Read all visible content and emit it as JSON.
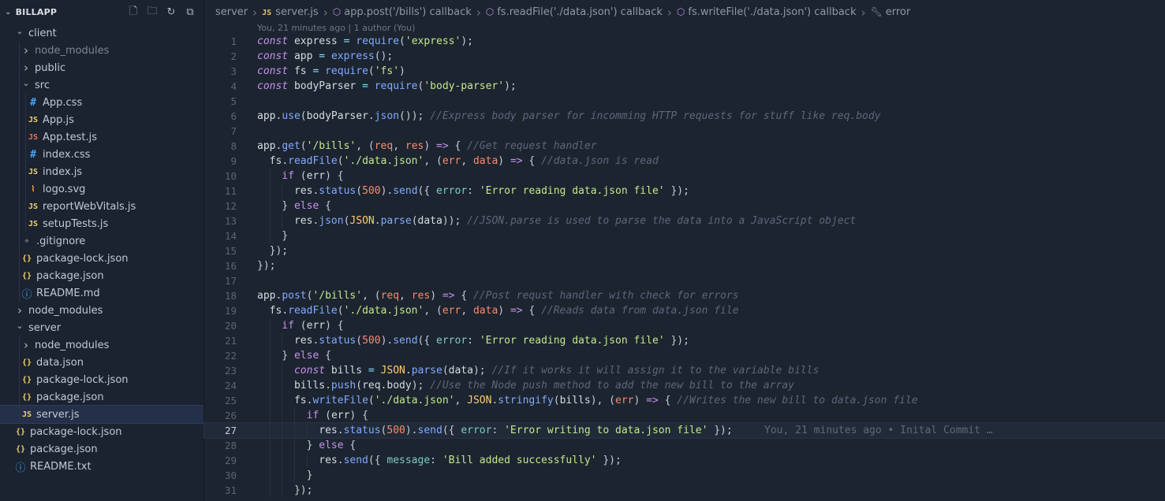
{
  "explorer": {
    "title": "BILLAPP",
    "actions": [
      {
        "name": "new-file-icon",
        "glyph": "🗋"
      },
      {
        "name": "new-folder-icon",
        "glyph": "🗀"
      },
      {
        "name": "refresh-icon",
        "glyph": "↻"
      },
      {
        "name": "collapse-all-icon",
        "glyph": "⧉"
      }
    ],
    "tree": [
      {
        "label": "client",
        "type": "folder",
        "open": true,
        "depth": 0
      },
      {
        "label": "node_modules",
        "type": "folder",
        "open": false,
        "depth": 1,
        "dim": true
      },
      {
        "label": "public",
        "type": "folder",
        "open": false,
        "depth": 1
      },
      {
        "label": "src",
        "type": "folder",
        "open": true,
        "depth": 1
      },
      {
        "label": "App.css",
        "type": "css",
        "depth": 2
      },
      {
        "label": "App.js",
        "type": "js",
        "depth": 2
      },
      {
        "label": "App.test.js",
        "type": "test",
        "depth": 2
      },
      {
        "label": "index.css",
        "type": "css",
        "depth": 2
      },
      {
        "label": "index.js",
        "type": "js",
        "depth": 2
      },
      {
        "label": "logo.svg",
        "type": "svg",
        "depth": 2
      },
      {
        "label": "reportWebVitals.js",
        "type": "js",
        "depth": 2
      },
      {
        "label": "setupTests.js",
        "type": "js",
        "depth": 2
      },
      {
        "label": ".gitignore",
        "type": "git",
        "depth": 1
      },
      {
        "label": "package-lock.json",
        "type": "json",
        "depth": 1
      },
      {
        "label": "package.json",
        "type": "json",
        "depth": 1
      },
      {
        "label": "README.md",
        "type": "info",
        "depth": 1
      },
      {
        "label": "node_modules",
        "type": "folder",
        "open": false,
        "depth": 0
      },
      {
        "label": "server",
        "type": "folder",
        "open": true,
        "depth": 0
      },
      {
        "label": "node_modules",
        "type": "folder",
        "open": false,
        "depth": 1
      },
      {
        "label": "data.json",
        "type": "json",
        "depth": 1
      },
      {
        "label": "package-lock.json",
        "type": "json",
        "depth": 1
      },
      {
        "label": "package.json",
        "type": "json",
        "depth": 1
      },
      {
        "label": "server.js",
        "type": "js",
        "depth": 1,
        "selected": true
      },
      {
        "label": "package-lock.json",
        "type": "json",
        "depth": 0,
        "nochev": true
      },
      {
        "label": "package.json",
        "type": "json",
        "depth": 0,
        "nochev": true
      },
      {
        "label": "README.txt",
        "type": "info",
        "depth": 0,
        "nochev": true
      }
    ],
    "icons": {
      "css": {
        "glyph": "#",
        "color": "#42a5f5",
        "name": "css-file-icon"
      },
      "js": {
        "glyph": "JS",
        "color": "#f0d267",
        "name": "js-file-icon"
      },
      "test": {
        "glyph": "JS",
        "color": "#f0704f",
        "name": "test-file-icon"
      },
      "svg": {
        "glyph": "⌇",
        "color": "#ffb13b",
        "name": "svg-file-icon"
      },
      "git": {
        "glyph": "◆",
        "color": "#58606c",
        "name": "git-file-icon"
      },
      "json": {
        "glyph": "{}",
        "color": "#f0d267",
        "name": "json-file-icon"
      },
      "info": {
        "glyph": "ⓘ",
        "color": "#42a5f5",
        "name": "info-file-icon"
      }
    }
  },
  "breadcrumb": {
    "items": [
      {
        "label": "server",
        "icon": ""
      },
      {
        "label": "server.js",
        "icon": "js"
      },
      {
        "label": "app.post('/bills') callback",
        "icon": "cube"
      },
      {
        "label": "fs.readFile('./data.json') callback",
        "icon": "cube"
      },
      {
        "label": "fs.writeFile('./data.json') callback",
        "icon": "cube"
      },
      {
        "label": "error",
        "icon": "wrench"
      }
    ]
  },
  "blame": {
    "top": "You, 21 minutes ago | 1 author (You)",
    "inline": "You, 21 minutes ago • Inital Commit …",
    "current_line": 27
  },
  "code": [
    [
      [
        "kw",
        "const"
      ],
      [
        "id",
        " express "
      ],
      [
        "pu",
        "="
      ],
      [
        "id",
        " "
      ],
      [
        "fn",
        "require"
      ],
      [
        "pl",
        "("
      ],
      [
        "str",
        "'express'"
      ],
      [
        "pl",
        ");"
      ]
    ],
    [
      [
        "kw",
        "const"
      ],
      [
        "id",
        " app "
      ],
      [
        "pu",
        "="
      ],
      [
        "id",
        " "
      ],
      [
        "fn",
        "express"
      ],
      [
        "pl",
        "();"
      ]
    ],
    [
      [
        "kw",
        "const"
      ],
      [
        "id",
        " fs "
      ],
      [
        "pu",
        "="
      ],
      [
        "id",
        " "
      ],
      [
        "fn",
        "require"
      ],
      [
        "pl",
        "("
      ],
      [
        "str",
        "'fs'"
      ],
      [
        "pl",
        ")"
      ]
    ],
    [
      [
        "kw",
        "const"
      ],
      [
        "id",
        " bodyParser "
      ],
      [
        "pu",
        "="
      ],
      [
        "id",
        " "
      ],
      [
        "fn",
        "require"
      ],
      [
        "pl",
        "("
      ],
      [
        "str",
        "'body-parser'"
      ],
      [
        "pl",
        ");"
      ]
    ],
    [],
    [
      [
        "id",
        "app"
      ],
      [
        "pl",
        "."
      ],
      [
        "fn",
        "use"
      ],
      [
        "pl",
        "("
      ],
      [
        "id",
        "bodyParser"
      ],
      [
        "pl",
        "."
      ],
      [
        "fn",
        "json"
      ],
      [
        "pl",
        "()); "
      ],
      [
        "cm",
        "//Express body parser for incomming HTTP requests for stuff like req.body"
      ]
    ],
    [],
    [
      [
        "id",
        "app"
      ],
      [
        "pl",
        "."
      ],
      [
        "fn",
        "get"
      ],
      [
        "pl",
        "("
      ],
      [
        "str",
        "'/bills'"
      ],
      [
        "pl",
        ", ("
      ],
      [
        "pm",
        "req"
      ],
      [
        "pl",
        ", "
      ],
      [
        "pm",
        "res"
      ],
      [
        "pl",
        ") "
      ],
      [
        "kw2",
        "=>"
      ],
      [
        "pl",
        " { "
      ],
      [
        "cm",
        "//Get request handler"
      ]
    ],
    [
      [
        "id",
        "  fs"
      ],
      [
        "pl",
        "."
      ],
      [
        "fn",
        "readFile"
      ],
      [
        "pl",
        "("
      ],
      [
        "str",
        "'./data.json'"
      ],
      [
        "pl",
        ", ("
      ],
      [
        "pm",
        "err"
      ],
      [
        "pl",
        ", "
      ],
      [
        "pm",
        "data"
      ],
      [
        "pl",
        ") "
      ],
      [
        "kw2",
        "=>"
      ],
      [
        "pl",
        " { "
      ],
      [
        "cm",
        "//data.json is read"
      ]
    ],
    [
      [
        "kw2",
        "    if"
      ],
      [
        "pl",
        " ("
      ],
      [
        "id",
        "err"
      ],
      [
        "pl",
        ") {"
      ]
    ],
    [
      [
        "id",
        "      res"
      ],
      [
        "pl",
        "."
      ],
      [
        "fn",
        "status"
      ],
      [
        "pl",
        "("
      ],
      [
        "num",
        "500"
      ],
      [
        "pl",
        ")."
      ],
      [
        "fn",
        "send"
      ],
      [
        "pl",
        "({ "
      ],
      [
        "prop",
        "error"
      ],
      [
        "pl",
        ": "
      ],
      [
        "str",
        "'Error reading data.json file'"
      ],
      [
        "pl",
        " });"
      ]
    ],
    [
      [
        "pl",
        "    } "
      ],
      [
        "kw2",
        "else"
      ],
      [
        "pl",
        " {"
      ]
    ],
    [
      [
        "id",
        "      res"
      ],
      [
        "pl",
        "."
      ],
      [
        "fn",
        "json"
      ],
      [
        "pl",
        "("
      ],
      [
        "cls",
        "JSON"
      ],
      [
        "pl",
        "."
      ],
      [
        "fn",
        "parse"
      ],
      [
        "pl",
        "("
      ],
      [
        "id",
        "data"
      ],
      [
        "pl",
        "));"
      ],
      [
        "cm",
        " //JSON.parse is used to parse the data into a JavaScript object"
      ]
    ],
    [
      [
        "pl",
        "    }"
      ]
    ],
    [
      [
        "pl",
        "  });"
      ]
    ],
    [
      [
        "pl",
        "});"
      ]
    ],
    [],
    [
      [
        "id",
        "app"
      ],
      [
        "pl",
        "."
      ],
      [
        "fn",
        "post"
      ],
      [
        "pl",
        "("
      ],
      [
        "str",
        "'/bills'"
      ],
      [
        "pl",
        ", ("
      ],
      [
        "pm",
        "req"
      ],
      [
        "pl",
        ", "
      ],
      [
        "pm",
        "res"
      ],
      [
        "pl",
        ") "
      ],
      [
        "kw2",
        "=>"
      ],
      [
        "pl",
        " { "
      ],
      [
        "cm",
        "//Post requst handler with check for errors"
      ]
    ],
    [
      [
        "id",
        "  fs"
      ],
      [
        "pl",
        "."
      ],
      [
        "fn",
        "readFile"
      ],
      [
        "pl",
        "("
      ],
      [
        "str",
        "'./data.json'"
      ],
      [
        "pl",
        ", ("
      ],
      [
        "pm",
        "err"
      ],
      [
        "pl",
        ", "
      ],
      [
        "pm",
        "data"
      ],
      [
        "pl",
        ") "
      ],
      [
        "kw2",
        "=>"
      ],
      [
        "pl",
        " { "
      ],
      [
        "cm",
        "//Reads data from data.json file"
      ]
    ],
    [
      [
        "kw2",
        "    if"
      ],
      [
        "pl",
        " ("
      ],
      [
        "id",
        "err"
      ],
      [
        "pl",
        ") {"
      ]
    ],
    [
      [
        "id",
        "      res"
      ],
      [
        "pl",
        "."
      ],
      [
        "fn",
        "status"
      ],
      [
        "pl",
        "("
      ],
      [
        "num",
        "500"
      ],
      [
        "pl",
        ")."
      ],
      [
        "fn",
        "send"
      ],
      [
        "pl",
        "({ "
      ],
      [
        "prop",
        "error"
      ],
      [
        "pl",
        ": "
      ],
      [
        "str",
        "'Error reading data.json file'"
      ],
      [
        "pl",
        " });"
      ]
    ],
    [
      [
        "pl",
        "    } "
      ],
      [
        "kw2",
        "else"
      ],
      [
        "pl",
        " {"
      ]
    ],
    [
      [
        "kw",
        "      const"
      ],
      [
        "id",
        " bills "
      ],
      [
        "pu",
        "="
      ],
      [
        "pl",
        " "
      ],
      [
        "cls",
        "JSON"
      ],
      [
        "pl",
        "."
      ],
      [
        "fn",
        "parse"
      ],
      [
        "pl",
        "("
      ],
      [
        "id",
        "data"
      ],
      [
        "pl",
        ");"
      ],
      [
        "cm",
        " //If it works it will assign it to the variable bills"
      ]
    ],
    [
      [
        "id",
        "      bills"
      ],
      [
        "pl",
        "."
      ],
      [
        "fn",
        "push"
      ],
      [
        "pl",
        "("
      ],
      [
        "id",
        "req"
      ],
      [
        "pl",
        "."
      ],
      [
        "id",
        "body"
      ],
      [
        "pl",
        ");"
      ],
      [
        "cm",
        " //Use the Node push method to add the new bill to the array"
      ]
    ],
    [
      [
        "id",
        "      fs"
      ],
      [
        "pl",
        "."
      ],
      [
        "fn",
        "writeFile"
      ],
      [
        "pl",
        "("
      ],
      [
        "str",
        "'./data.json'"
      ],
      [
        "pl",
        ", "
      ],
      [
        "cls",
        "JSON"
      ],
      [
        "pl",
        "."
      ],
      [
        "fn",
        "stringify"
      ],
      [
        "pl",
        "("
      ],
      [
        "id",
        "bills"
      ],
      [
        "pl",
        "), ("
      ],
      [
        "pm",
        "err"
      ],
      [
        "pl",
        ") "
      ],
      [
        "kw2",
        "=>"
      ],
      [
        "pl",
        " { "
      ],
      [
        "cm",
        "//Writes the new bill to data.json file"
      ]
    ],
    [
      [
        "kw2",
        "        if"
      ],
      [
        "pl",
        " ("
      ],
      [
        "id",
        "err"
      ],
      [
        "pl",
        ") {"
      ]
    ],
    [
      [
        "id",
        "          res"
      ],
      [
        "pl",
        "."
      ],
      [
        "fn",
        "status"
      ],
      [
        "pl",
        "("
      ],
      [
        "num",
        "500"
      ],
      [
        "pl",
        ")."
      ],
      [
        "fn",
        "send"
      ],
      [
        "pl",
        "({ "
      ],
      [
        "prop",
        "error"
      ],
      [
        "pl",
        ": "
      ],
      [
        "str",
        "'Error writing to data.json file'"
      ],
      [
        "pl",
        " });"
      ]
    ],
    [
      [
        "pl",
        "        } "
      ],
      [
        "kw2",
        "else"
      ],
      [
        "pl",
        " {"
      ]
    ],
    [
      [
        "id",
        "          res"
      ],
      [
        "pl",
        "."
      ],
      [
        "fn",
        "send"
      ],
      [
        "pl",
        "({ "
      ],
      [
        "prop",
        "message"
      ],
      [
        "pl",
        ": "
      ],
      [
        "str",
        "'Bill added successfully'"
      ],
      [
        "pl",
        " });"
      ]
    ],
    [
      [
        "pl",
        "        }"
      ]
    ],
    [
      [
        "pl",
        "      });"
      ]
    ]
  ]
}
